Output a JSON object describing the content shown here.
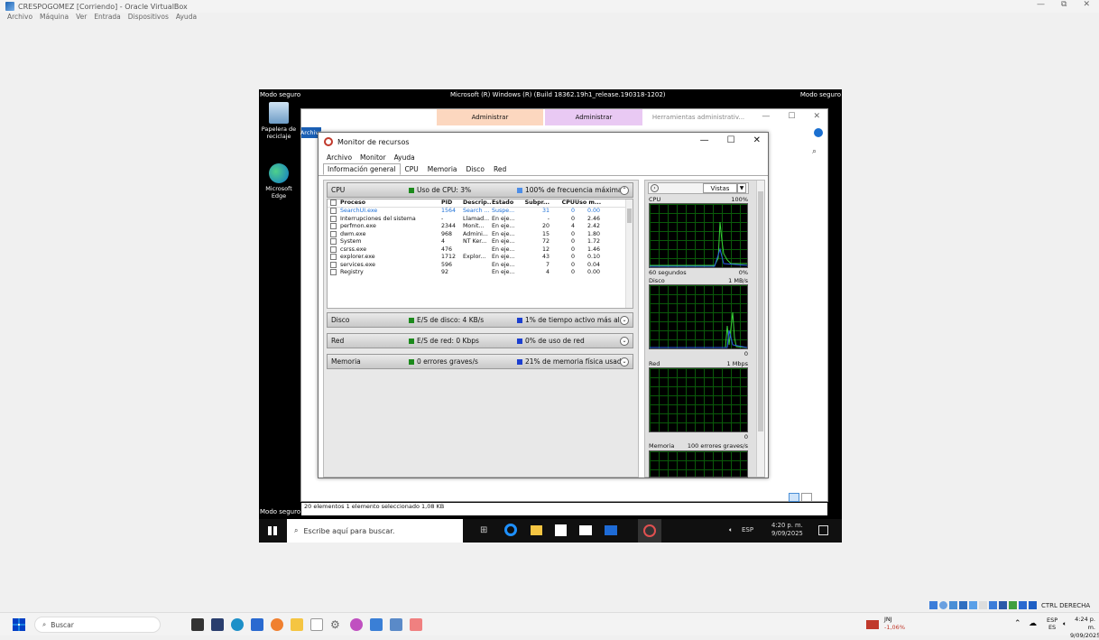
{
  "vbox": {
    "title": "CRESPOGOMEZ [Corriendo] - Oracle VirtualBox",
    "menu": [
      "Archivo",
      "Máquina",
      "Ver",
      "Entrada",
      "Dispositivos",
      "Ayuda"
    ]
  },
  "guest": {
    "mode_label": "Modo seguro",
    "build": "Microsoft (R) Windows (R) (Build 18362.19h1_release.190318-1202)",
    "desktop_icons": [
      "Papelera de reciclaje",
      "Microsoft Edge"
    ],
    "explorer": {
      "tab_admin1": "Administrar",
      "tab_admin2": "Administrar",
      "tab_tools": "Herramientas administrativ...",
      "file_tab": "Archivo",
      "status": "20 elementos    1 elemento seleccionado  1,08 KB"
    },
    "taskbar": {
      "search_placeholder": "Escribe aquí para buscar.",
      "lang": "ESP",
      "time": "4:20 p. m.",
      "date": "9/09/2025"
    }
  },
  "resmon": {
    "title": "Monitor de recursos",
    "menu": [
      "Archivo",
      "Monitor",
      "Ayuda"
    ],
    "tabs": [
      "Información general",
      "CPU",
      "Memoria",
      "Disco",
      "Red"
    ],
    "cpu": {
      "label": "CPU",
      "usage": "Uso de CPU: 3%",
      "freq": "100% de frecuencia máxima"
    },
    "columns": [
      "Proceso",
      "PID",
      "Descrip...",
      "Estado",
      "Subpr...",
      "CPU",
      "Uso m..."
    ],
    "processes": [
      [
        "SearchUI.exe",
        "1564",
        "Search ...",
        "Suspe...",
        "31",
        "0",
        "0.00"
      ],
      [
        "Interrupciones del sistema",
        "-",
        "Llamad...",
        "En eje...",
        "-",
        "0",
        "2.46"
      ],
      [
        "perfmon.exe",
        "2344",
        "Monit...",
        "En eje...",
        "20",
        "4",
        "2.42"
      ],
      [
        "dwm.exe",
        "968",
        "Admini...",
        "En eje...",
        "15",
        "0",
        "1.80"
      ],
      [
        "System",
        "4",
        "NT Ker...",
        "En eje...",
        "72",
        "0",
        "1.72"
      ],
      [
        "csrss.exe",
        "476",
        "",
        "En eje...",
        "12",
        "0",
        "1.46"
      ],
      [
        "explorer.exe",
        "1712",
        "Explor...",
        "En eje...",
        "43",
        "0",
        "0.10"
      ],
      [
        "services.exe",
        "596",
        "",
        "En eje...",
        "7",
        "0",
        "0.04"
      ],
      [
        "Registry",
        "92",
        "",
        "En eje...",
        "4",
        "0",
        "0.00"
      ]
    ],
    "disk": {
      "label": "Disco",
      "io": "E/S de disco: 4 KB/s",
      "active": "1% de tiempo activo más al..."
    },
    "net": {
      "label": "Red",
      "io": "E/S de red: 0 Kbps",
      "usage": "0% de uso de red"
    },
    "mem": {
      "label": "Memoria",
      "faults": "0 errores graves/s",
      "usage": "21% de memoria física usada"
    },
    "views_label": "Vistas",
    "graphs": {
      "cpu_label": "CPU",
      "cpu_max": "100%",
      "cpu_time": "60 segundos",
      "cpu_min": "0%",
      "disk_label": "Disco",
      "disk_max": "1 MB/s",
      "disk_min": "0",
      "net_label": "Red",
      "net_max": "1 Mbps",
      "net_min": "0",
      "mem_label": "Memoria",
      "mem_max": "100 errores graves/s"
    },
    "colors": {
      "green": "#1c8a1c",
      "blue": "#1c3fd0",
      "graph_line": "#39d339"
    }
  },
  "host": {
    "search": "Buscar",
    "stock_name": "JNJ",
    "stock_change": "-1,06%",
    "lang_top": "ESP",
    "lang_bottom": "ES",
    "time": "4:24 p. m.",
    "date": "9/09/2025",
    "hostkey": "CTRL DERECHA"
  }
}
